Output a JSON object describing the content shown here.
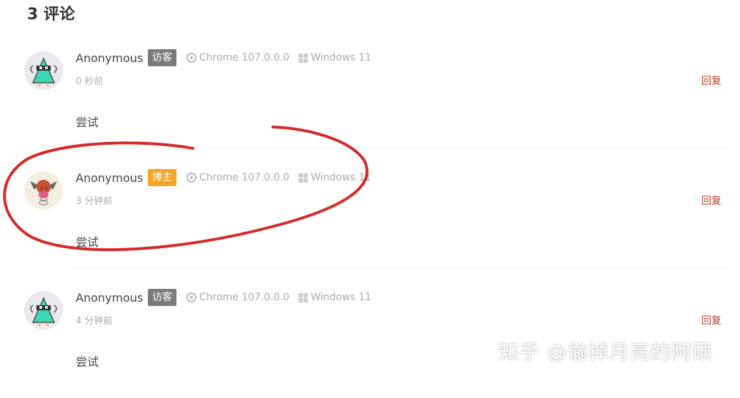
{
  "heading": "3 评论",
  "comments": [
    {
      "name": "Anonymous",
      "badge": "访客",
      "badge_color": "#7b7b7b",
      "browser": "Chrome 107.0.0.0",
      "os": "Windows 11",
      "time": "0 秒前",
      "reply": "回复",
      "text": "尝试",
      "avatar": "guest"
    },
    {
      "name": "Anonymous",
      "badge": "博主",
      "badge_color": "#f5a623",
      "browser": "Chrome 107.0.0.0",
      "os": "Windows 11",
      "time": "3 分钟前",
      "reply": "回复",
      "text": "尝试",
      "avatar": "owner"
    },
    {
      "name": "Anonymous",
      "badge": "访客",
      "badge_color": "#7b7b7b",
      "browser": "Chrome 107.0.0.0",
      "os": "Windows 11",
      "time": "4 分钟前",
      "reply": "回复",
      "text": "尝试",
      "avatar": "guest"
    }
  ],
  "watermark": "知乎 @偷掉月亮的阿硕",
  "colors": {
    "reply": "#c0392b",
    "annotation": "#d42a2a"
  }
}
